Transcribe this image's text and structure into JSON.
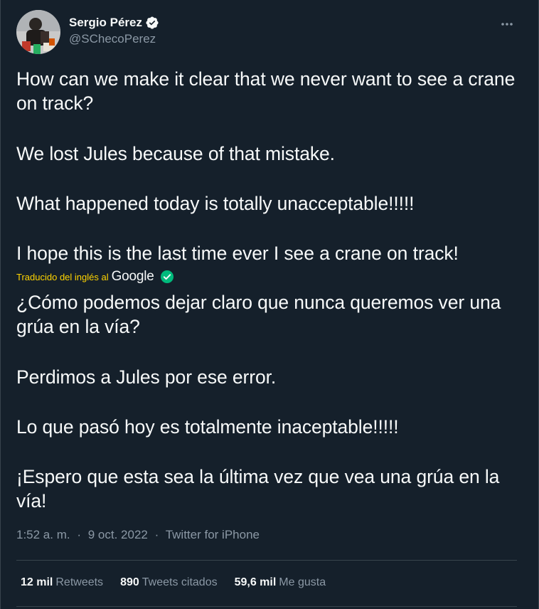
{
  "author": {
    "display_name": "Sergio Pérez",
    "handle": "@SChecoPerez",
    "verified_icon": "verified-badge-icon",
    "avatar_icon": "avatar"
  },
  "tweet": {
    "original": [
      "How can we make it clear that we never want to see a crane on track?",
      "We lost Jules because of that mistake.",
      "What happened today is totally unacceptable!!!!!",
      "I hope this is the last time ever I see a crane on track!"
    ],
    "translation_label": "Traducido del inglés al",
    "translation_provider": "Google",
    "translated": [
      "¿Cómo podemos dejar claro que nunca queremos ver una grúa en la vía?",
      "Perdimos a Jules por ese error.",
      "Lo que pasó hoy es totalmente inaceptable!!!!!",
      "¡Espero que esta sea la última vez que vea una grúa en la vía!"
    ]
  },
  "meta": {
    "time": "1:52 a. m.",
    "separator": "·",
    "date": "9 oct. 2022",
    "source": "Twitter for iPhone"
  },
  "stats": {
    "retweets_count": "12 mil",
    "retweets_label": "Retweets",
    "quotes_count": "890",
    "quotes_label": "Tweets citados",
    "likes_count": "59,6 mil",
    "likes_label": "Me gusta"
  },
  "colors": {
    "background": "#15202b",
    "text": "#f7f9f9",
    "muted": "#8b98a5",
    "translation_label": "#ffd400",
    "check": "#00ba7c",
    "divider": "#38444d"
  },
  "icons": {
    "more": "more-options-icon",
    "translation_check": "check-circle-icon"
  }
}
